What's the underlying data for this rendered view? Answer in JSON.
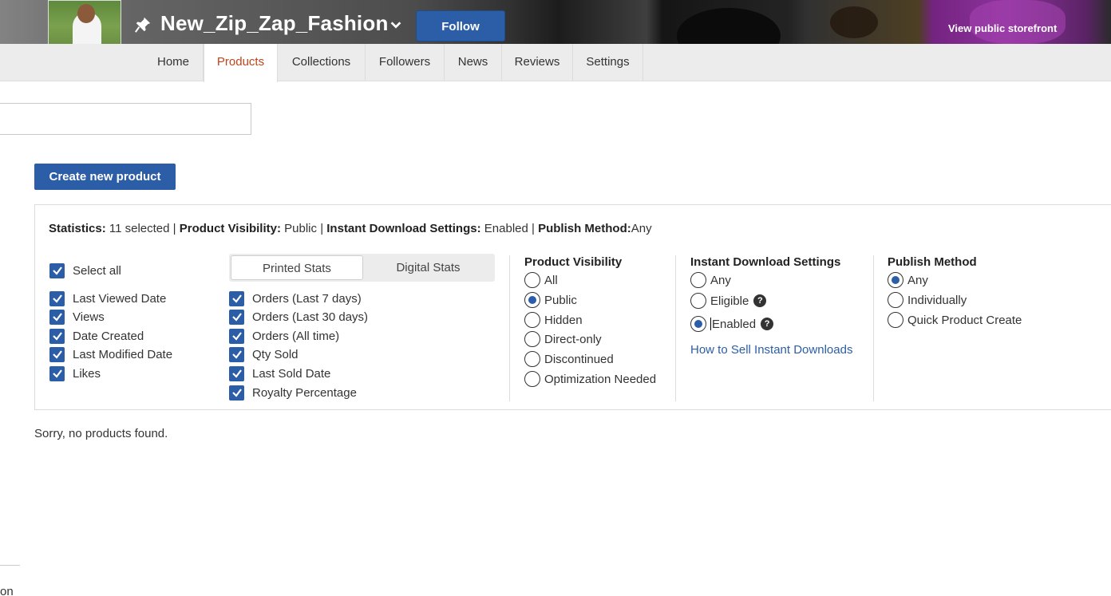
{
  "header": {
    "shop_name": "New_Zip_Zap_Fashion",
    "follow_label": "Follow",
    "storefront_label": "View public storefront"
  },
  "nav": {
    "tabs": [
      {
        "label": "Home",
        "active": false
      },
      {
        "label": "Products",
        "active": true
      },
      {
        "label": "Collections",
        "active": false
      },
      {
        "label": "Followers",
        "active": false
      },
      {
        "label": "News",
        "active": false
      },
      {
        "label": "Reviews",
        "active": false
      },
      {
        "label": "Settings",
        "active": false
      }
    ]
  },
  "search": {
    "value": "",
    "placeholder": ""
  },
  "create_button_label": "Create new product",
  "summary": {
    "stats_label": "Statistics:",
    "stats_value": "11 selected",
    "visibility_label": "Product Visibility:",
    "visibility_value": "Public",
    "instant_label": "Instant Download Settings:",
    "instant_value": "Enabled",
    "publish_label": "Publish Method:",
    "publish_value": "Any",
    "separator": "|"
  },
  "stats": {
    "select_all": {
      "label": "Select all",
      "checked": true
    },
    "left_items": [
      {
        "label": "Last Viewed Date",
        "checked": true
      },
      {
        "label": "Views",
        "checked": true
      },
      {
        "label": "Date Created",
        "checked": true
      },
      {
        "label": "Last Modified Date",
        "checked": true
      },
      {
        "label": "Likes",
        "checked": true
      }
    ],
    "tabs": [
      {
        "label": "Printed Stats",
        "active": true
      },
      {
        "label": "Digital Stats",
        "active": false
      }
    ],
    "printed_items": [
      {
        "label": "Orders (Last 7 days)",
        "checked": true
      },
      {
        "label": "Orders (Last 30 days)",
        "checked": true
      },
      {
        "label": "Orders (All time)",
        "checked": true
      },
      {
        "label": "Qty Sold",
        "checked": true
      },
      {
        "label": "Last Sold Date",
        "checked": true
      },
      {
        "label": "Royalty Percentage",
        "checked": true
      }
    ]
  },
  "visibility": {
    "title": "Product Visibility",
    "options": [
      {
        "label": "All",
        "selected": false
      },
      {
        "label": "Public",
        "selected": true
      },
      {
        "label": "Hidden",
        "selected": false
      },
      {
        "label": "Direct-only",
        "selected": false
      },
      {
        "label": "Discontinued",
        "selected": false
      },
      {
        "label": "Optimization Needed",
        "selected": false
      }
    ]
  },
  "instant": {
    "title": "Instant Download Settings",
    "options": [
      {
        "label": "Any",
        "selected": false
      },
      {
        "label": "Eligible",
        "selected": false
      },
      {
        "label": "Enabled",
        "selected": true
      }
    ],
    "help_glyph": "?",
    "link_label": "How to Sell Instant Downloads"
  },
  "publish": {
    "title": "Publish Method",
    "options": [
      {
        "label": "Any",
        "selected": true
      },
      {
        "label": "Individually",
        "selected": false
      },
      {
        "label": "Quick Product Create",
        "selected": false
      }
    ]
  },
  "empty_message": "Sorry, no products found.",
  "footer_fragment": "on",
  "colors": {
    "accent": "#2b5ea7",
    "active_tab": "#c1431c"
  }
}
